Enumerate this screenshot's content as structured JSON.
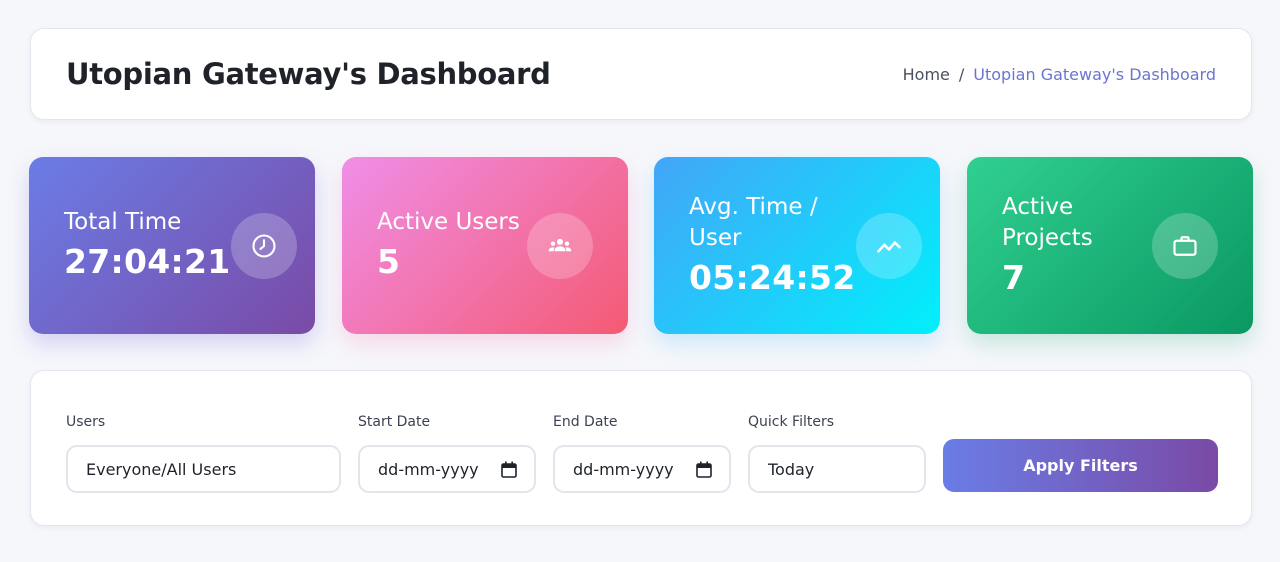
{
  "header": {
    "title": "Utopian Gateway's Dashboard",
    "breadcrumb": {
      "home": "Home",
      "separator": "/",
      "current": "Utopian Gateway's Dashboard"
    }
  },
  "stats": [
    {
      "label": "Total Time",
      "value": "27:04:21",
      "icon": "clock-icon"
    },
    {
      "label": "Active Users",
      "value": "5",
      "icon": "users-icon"
    },
    {
      "label": "Avg. Time / User",
      "value": "05:24:52",
      "icon": "trend-line-icon"
    },
    {
      "label": "Active Projects",
      "value": "7",
      "icon": "briefcase-icon"
    }
  ],
  "filters": {
    "users": {
      "label": "Users",
      "value": "Everyone/All Users"
    },
    "start_date": {
      "label": "Start Date",
      "value": "dd-mm-yyyy"
    },
    "end_date": {
      "label": "End Date",
      "value": "dd-mm-yyyy"
    },
    "quick_filters": {
      "label": "Quick Filters",
      "value": "Today"
    },
    "apply_label": "Apply Filters"
  },
  "colors": {
    "accent": "#6a75d2",
    "primary_gradient": [
      "#6a7de6",
      "#7a4aa6"
    ],
    "users_gradient": [
      "#f08ee8",
      "#f45a73"
    ],
    "avg_gradient": [
      "#43a5f8",
      "#00f0fc"
    ],
    "projects_gradient": [
      "#30d090",
      "#0a9862"
    ]
  }
}
